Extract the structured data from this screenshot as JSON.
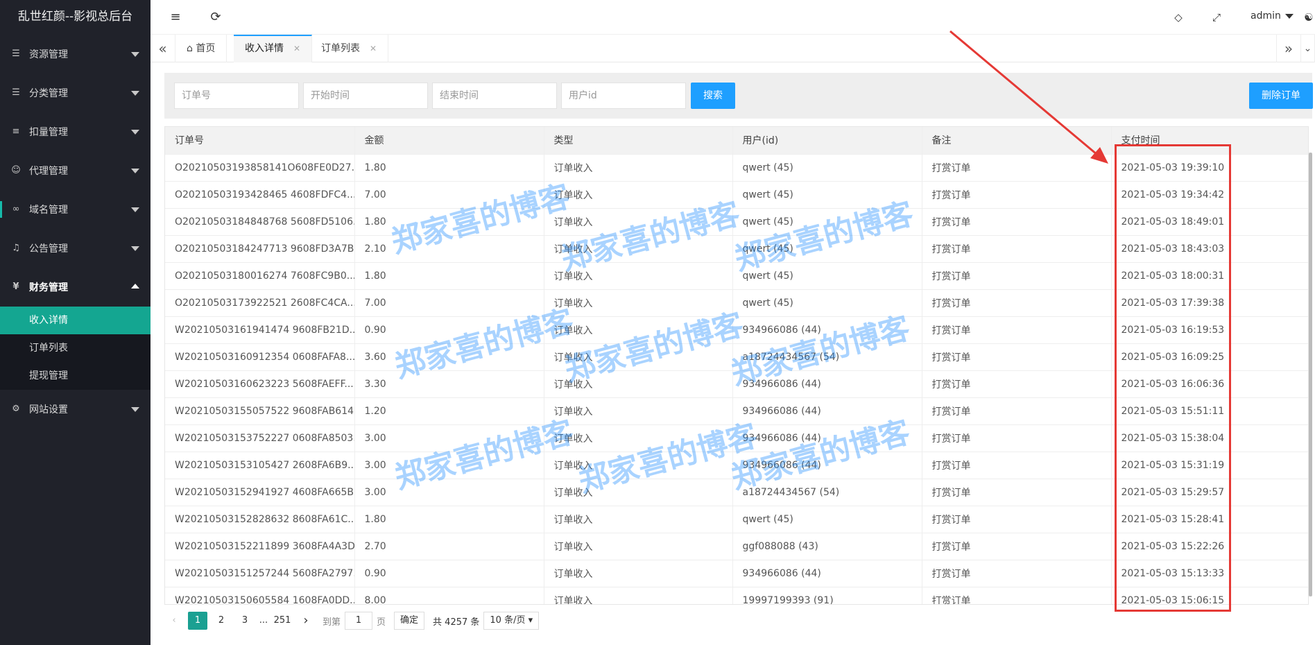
{
  "app": {
    "title": "乱世红颜--影视总后台"
  },
  "sidebar": {
    "menus": [
      {
        "label": "资源管理",
        "icon": "layers-icon"
      },
      {
        "label": "分类管理",
        "icon": "layers-icon"
      },
      {
        "label": "扣量管理",
        "icon": "list-indent-icon"
      },
      {
        "label": "代理管理",
        "icon": "user-icon"
      },
      {
        "label": "域名管理",
        "icon": "link-icon"
      },
      {
        "label": "公告管理",
        "icon": "speaker-icon"
      },
      {
        "label": "财务管理",
        "icon": "yen-icon"
      }
    ],
    "finance_sub": [
      {
        "label": "收入详情",
        "active": true
      },
      {
        "label": "订单列表",
        "active": false
      },
      {
        "label": "提现管理",
        "active": false
      }
    ],
    "settings": {
      "label": "网站设置",
      "icon": "gear-icon"
    }
  },
  "header": {
    "user": "admin"
  },
  "tabs": [
    {
      "label": "首页"
    },
    {
      "label": "收入详情"
    },
    {
      "label": "订单列表"
    }
  ],
  "search": {
    "order_no_placeholder": "订单号",
    "start_time_placeholder": "开始时间",
    "end_time_placeholder": "结束时间",
    "user_id_placeholder": "用户id",
    "search_label": "搜索",
    "delete_label": "删除订单"
  },
  "table": {
    "headers": [
      "订单号",
      "金额",
      "类型",
      "用户(id)",
      "备注",
      "支付时间"
    ],
    "rows": [
      [
        "O20210503193858141O608FE0D27...",
        "1.80",
        "订单收入",
        "qwert (45)",
        "打赏订单",
        "2021-05-03 19:39:10"
      ],
      [
        "O20210503193428465 4608FDFC4...",
        "7.00",
        "订单收入",
        "qwert (45)",
        "打赏订单",
        "2021-05-03 19:34:42"
      ],
      [
        "O20210503184848768 5608FD5106...",
        "1.80",
        "订单收入",
        "qwert (45)",
        "打赏订单",
        "2021-05-03 18:49:01"
      ],
      [
        "O20210503184247713 9608FD3A7B...",
        "2.10",
        "订单收入",
        "qwert (45)",
        "打赏订单",
        "2021-05-03 18:43:03"
      ],
      [
        "O20210503180016274 7608FC9B0...",
        "1.80",
        "订单收入",
        "qwert (45)",
        "打赏订单",
        "2021-05-03 18:00:31"
      ],
      [
        "O20210503173922521 2608FC4CA...",
        "7.00",
        "订单收入",
        "qwert (45)",
        "打赏订单",
        "2021-05-03 17:39:38"
      ],
      [
        "W20210503161941474 9608FB21D...",
        "0.90",
        "订单收入",
        "934966086 (44)",
        "打赏订单",
        "2021-05-03 16:19:53"
      ],
      [
        "W20210503160912354 0608FAFA8...",
        "3.60",
        "订单收入",
        "a18724434567 (54)",
        "打赏订单",
        "2021-05-03 16:09:25"
      ],
      [
        "W20210503160623223 5608FAEFF...",
        "3.30",
        "订单收入",
        "934966086 (44)",
        "打赏订单",
        "2021-05-03 16:06:36"
      ],
      [
        "W20210503155057522 9608FAB614...",
        "1.20",
        "订单收入",
        "934966086 (44)",
        "打赏订单",
        "2021-05-03 15:51:11"
      ],
      [
        "W20210503153752227 0608FA8503...",
        "3.00",
        "订单收入",
        "934966086 (44)",
        "打赏订单",
        "2021-05-03 15:38:04"
      ],
      [
        "W20210503153105427 2608FA6B9...",
        "3.00",
        "订单收入",
        "934966086 (44)",
        "打赏订单",
        "2021-05-03 15:31:19"
      ],
      [
        "W20210503152941927 4608FA665B...",
        "3.00",
        "订单收入",
        "a18724434567 (54)",
        "打赏订单",
        "2021-05-03 15:29:57"
      ],
      [
        "W20210503152828632 8608FA61C...",
        "1.80",
        "订单收入",
        "qwert (45)",
        "打赏订单",
        "2021-05-03 15:28:41"
      ],
      [
        "W20210503152211899 3608FA4A3D...",
        "2.70",
        "订单收入",
        "ggf088088 (43)",
        "打赏订单",
        "2021-05-03 15:22:26"
      ],
      [
        "W20210503151257244 5608FA2797...",
        "0.90",
        "订单收入",
        "934966086 (44)",
        "打赏订单",
        "2021-05-03 15:13:33"
      ],
      [
        "W20210503150605584 1608FA0DD...",
        "8.00",
        "订单收入",
        "19997199393 (91)",
        "打赏订单",
        "2021-05-03 15:06:15"
      ]
    ]
  },
  "pagination": {
    "current": "1",
    "pages": [
      "2",
      "3"
    ],
    "ellipsis": "...",
    "last": "251",
    "goto_label": "到第",
    "goto_value": "1",
    "page_unit": "页",
    "confirm": "确定",
    "total": "共 4257 条",
    "page_size": "10 条/页"
  },
  "watermark": "郑家喜的博客",
  "colors": {
    "sidebar_bg": "#20222a",
    "accent": "#1e9fff",
    "active_menu": "#14a691",
    "annotation": "#e53935"
  }
}
